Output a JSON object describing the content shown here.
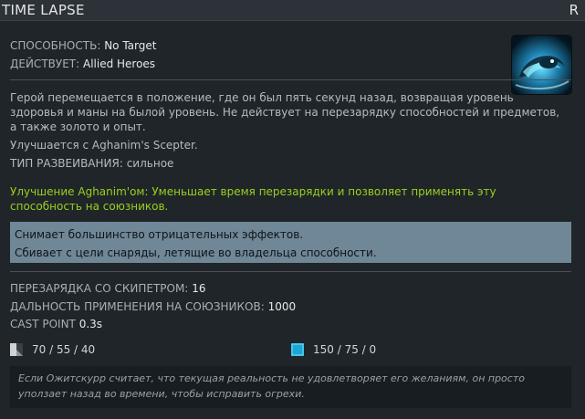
{
  "header": {
    "title": "TIME LAPSE",
    "hotkey": "R"
  },
  "meta": {
    "ability_label": "СПОСОБНОСТЬ:",
    "ability_value": "No Target",
    "affects_label": "ДЕЙСТВУЕТ:",
    "affects_value": "Allied Heroes"
  },
  "description": "Герой перемещается в положение, где он был пять секунд назад, возвращая уровень здоровья и маны на былой уровень. Не действует на перезарядку способностей и предметов, а также золото и опыт.",
  "upgrade_note": "Улучшается с Aghanim's Scepter.",
  "upgrade_type": "ТИП РАЗВЕИВАНИЯ: сильное",
  "scepter_text": "Улучшение Aghanim'ом: Уменьшает время перезарядки и позволяет применять эту способность на союзников.",
  "notes": [
    "Снимает большинство отрицательных эффектов.",
    "Сбивает с цели снаряды, летящие во владельца способности."
  ],
  "stats": {
    "cooldown_scepter_label": "ПЕРЕЗАРЯДКА СО СКИПЕТРОМ:",
    "cooldown_scepter_value": "16",
    "ally_range_label": "ДАЛЬНОСТЬ ПРИМЕНЕНИЯ НА СОЮЗНИКОВ:",
    "ally_range_value": "1000",
    "cast_point_label": "CAST POINT",
    "cast_point_value": "0.3s"
  },
  "costs": {
    "cooldown": "70 / 55 / 40",
    "mana": "150 / 75 / 0",
    "cooldown_icon": "cooldown-icon",
    "mana_icon": "mana-icon",
    "mana_color": "#1aa7d6"
  },
  "lore": "Если Ожитскурр считает, что текущая реальность не удовлетворяет его желаниям, он просто уползает назад во времени, чтобы исправить огрехи."
}
